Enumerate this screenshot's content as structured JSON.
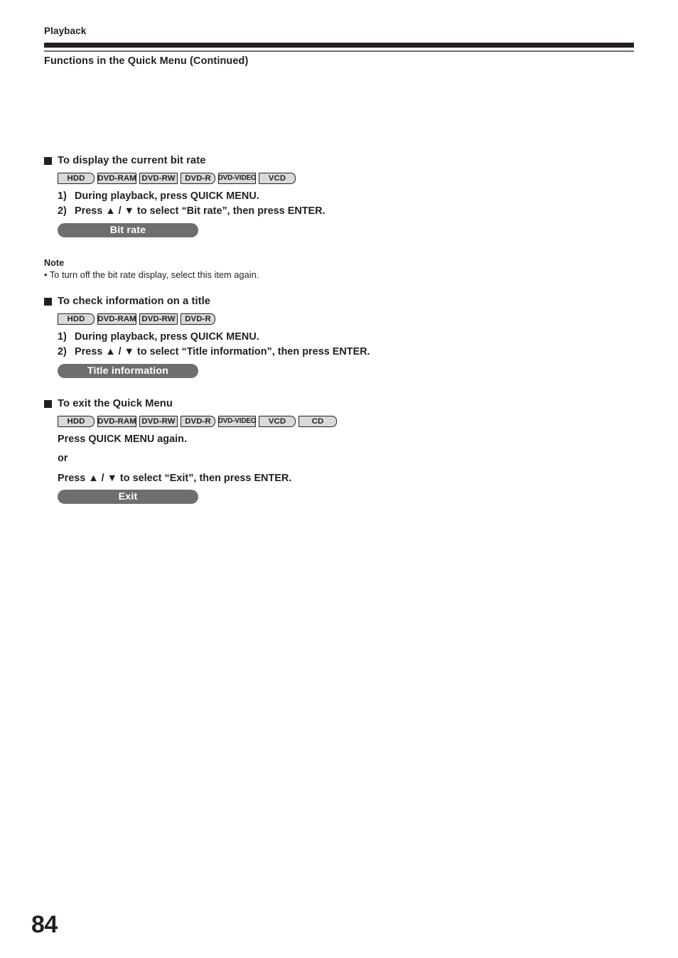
{
  "header": {
    "running_head": "Playback",
    "section_title": "Functions in the Quick Menu (Continued)"
  },
  "blocks": [
    {
      "heading": "To display the current bit rate",
      "badges": [
        {
          "label": "HDD",
          "style": "round"
        },
        {
          "label": "DVD-RAM",
          "style": "square"
        },
        {
          "label": "DVD-RW",
          "style": "square"
        },
        {
          "label": "DVD-R",
          "style": "round"
        },
        {
          "label": "DVD-VIDEO",
          "style": "square"
        },
        {
          "label": "VCD",
          "style": "round"
        }
      ],
      "steps": [
        {
          "num": "1)",
          "text": "During playback, press QUICK MENU."
        },
        {
          "num": "2)",
          "text": "Press ▲ / ▼ to select “Bit rate”, then press ENTER."
        }
      ],
      "pill": "Bit rate"
    },
    {
      "heading": "To check information on a title",
      "badges": [
        {
          "label": "HDD",
          "style": "round"
        },
        {
          "label": "DVD-RAM",
          "style": "square"
        },
        {
          "label": "DVD-RW",
          "style": "square"
        },
        {
          "label": "DVD-R",
          "style": "round"
        }
      ],
      "steps": [
        {
          "num": "1)",
          "text": "During playback, press QUICK MENU."
        },
        {
          "num": "2)",
          "text": "Press ▲ / ▼ to select “Title information”, then press ENTER."
        }
      ],
      "pill": "Title information"
    },
    {
      "heading": "To exit the Quick Menu",
      "badges": [
        {
          "label": "HDD",
          "style": "round"
        },
        {
          "label": "DVD-RAM",
          "style": "square"
        },
        {
          "label": "DVD-RW",
          "style": "square"
        },
        {
          "label": "DVD-R",
          "style": "round"
        },
        {
          "label": "DVD-VIDEO",
          "style": "square"
        },
        {
          "label": "VCD",
          "style": "round"
        },
        {
          "label": "CD",
          "style": "round"
        }
      ],
      "lines": [
        "Press QUICK MENU again.",
        "or",
        "Press ▲ / ▼ to select “Exit”, then press ENTER."
      ],
      "pill": "Exit"
    }
  ],
  "note": {
    "title": "Note",
    "item": "• To turn off the bit rate display, select this item again."
  },
  "folio": "84"
}
